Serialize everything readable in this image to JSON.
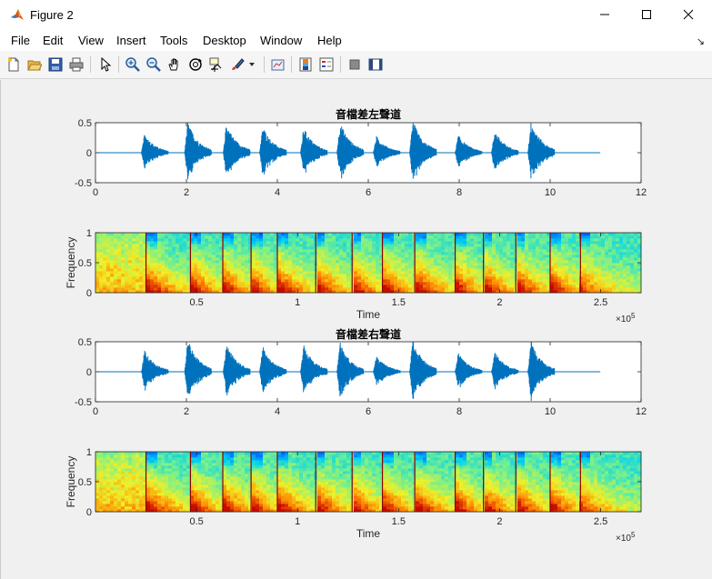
{
  "window": {
    "title": "Figure 2",
    "icon": "matlab-logo-icon"
  },
  "menu": [
    "File",
    "Edit",
    "View",
    "Insert",
    "Tools",
    "Desktop",
    "Window",
    "Help"
  ],
  "toolbar_icons": [
    "new-figure-icon",
    "open-file-icon",
    "save-icon",
    "print-icon",
    "edit-plot-arrow-icon",
    "zoom-in-icon",
    "zoom-out-icon",
    "pan-hand-icon",
    "rotate-3d-icon",
    "data-cursor-icon",
    "brush-icon",
    "brush-dropdown-icon",
    "link-plot-icon",
    "insert-colorbar-icon",
    "insert-legend-icon",
    "hide-plot-tools-icon",
    "show-plot-tools-icon"
  ],
  "colors": {
    "waveform": "#0072bd",
    "axes_background": "#ffffff",
    "figure_background": "#f0f0f0"
  },
  "chart_data": [
    {
      "type": "line",
      "title": "音檔差左聲道",
      "xlabel": "",
      "ylabel": "",
      "xlim": [
        0,
        12
      ],
      "ylim": [
        -0.5,
        0.5
      ],
      "xticks": [
        "0",
        "2",
        "4",
        "6",
        "8",
        "10",
        "12"
      ],
      "yticks": [
        "0.5",
        "0",
        "-0.5"
      ],
      "bursts": [
        {
          "t": 1.05,
          "amp": 0.32
        },
        {
          "t": 2.0,
          "amp": 0.52
        },
        {
          "t": 2.85,
          "amp": 0.5
        },
        {
          "t": 3.65,
          "amp": 0.45
        },
        {
          "t": 4.55,
          "amp": 0.43
        },
        {
          "t": 5.35,
          "amp": 0.52
        },
        {
          "t": 6.15,
          "amp": 0.28
        },
        {
          "t": 6.95,
          "amp": 0.55
        },
        {
          "t": 7.95,
          "amp": 0.3
        },
        {
          "t": 8.75,
          "amp": 0.38
        },
        {
          "t": 9.55,
          "amp": 0.55
        }
      ],
      "signal_end": 11.1
    },
    {
      "type": "heatmap",
      "title": "",
      "xlabel": "Time",
      "ylabel": "Frequency",
      "xlim": [
        0,
        2.7
      ],
      "ylim": [
        0,
        1
      ],
      "xticks": [
        "0.5",
        "1",
        "1.5",
        "2",
        "2.5"
      ],
      "yticks": [
        "1",
        "0.5",
        "0"
      ],
      "x_exponent": "×10",
      "x_exponent_power": "5",
      "segment_boundaries": [
        0.25,
        0.47,
        0.63,
        0.77,
        0.9,
        1.09,
        1.27,
        1.42,
        1.58,
        1.78,
        1.92,
        2.08,
        2.25,
        2.4
      ]
    },
    {
      "type": "line",
      "title": "音檔差右聲道",
      "xlabel": "",
      "ylabel": "",
      "xlim": [
        0,
        12
      ],
      "ylim": [
        -0.5,
        0.5
      ],
      "xticks": [
        "0",
        "2",
        "4",
        "6",
        "8",
        "10",
        "12"
      ],
      "yticks": [
        "0.5",
        "0",
        "-0.5"
      ],
      "bursts": [
        {
          "t": 1.05,
          "amp": 0.36
        },
        {
          "t": 2.0,
          "amp": 0.55
        },
        {
          "t": 2.85,
          "amp": 0.48
        },
        {
          "t": 3.65,
          "amp": 0.43
        },
        {
          "t": 4.55,
          "amp": 0.45
        },
        {
          "t": 5.35,
          "amp": 0.5
        },
        {
          "t": 6.15,
          "amp": 0.27
        },
        {
          "t": 6.95,
          "amp": 0.55
        },
        {
          "t": 7.95,
          "amp": 0.32
        },
        {
          "t": 8.75,
          "amp": 0.34
        },
        {
          "t": 9.55,
          "amp": 0.52
        }
      ],
      "signal_end": 11.1
    },
    {
      "type": "heatmap",
      "title": "",
      "xlabel": "Time",
      "ylabel": "Frequency",
      "xlim": [
        0,
        2.7
      ],
      "ylim": [
        0,
        1
      ],
      "xticks": [
        "0.5",
        "1",
        "1.5",
        "2",
        "2.5"
      ],
      "yticks": [
        "1",
        "0.5",
        "0"
      ],
      "x_exponent": "×10",
      "x_exponent_power": "5",
      "segment_boundaries": [
        0.25,
        0.47,
        0.63,
        0.77,
        0.9,
        1.09,
        1.27,
        1.42,
        1.58,
        1.78,
        1.92,
        2.08,
        2.25,
        2.4
      ]
    }
  ]
}
